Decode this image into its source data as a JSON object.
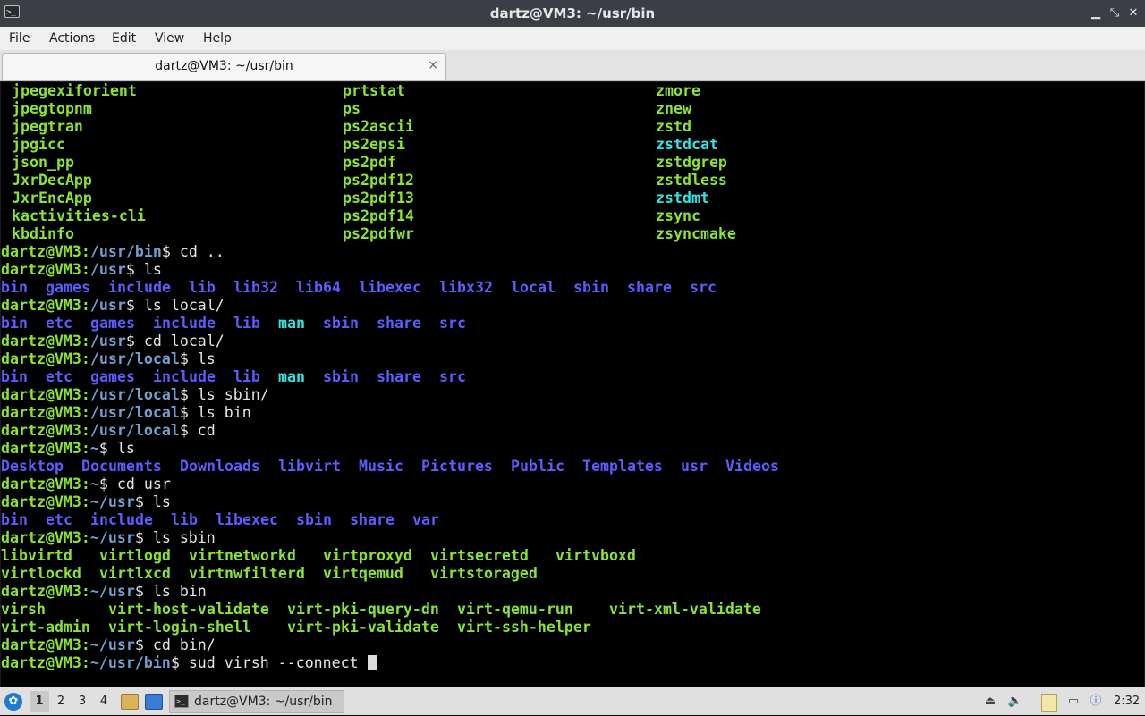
{
  "window": {
    "title": "dartz@VM3: ~/usr/bin",
    "buttons": {
      "minimize": "▁",
      "maximize": "⤡",
      "close": "✕"
    }
  },
  "menu": [
    "File",
    "Actions",
    "Edit",
    "View",
    "Help"
  ],
  "tab": {
    "label": "dartz@VM3: ~/usr/bin",
    "close": "×"
  },
  "terminal": {
    "listing_rows": [
      [
        "jpegexiforient",
        "prtstat",
        "zmore"
      ],
      [
        "jpegtopnm",
        "ps",
        "znew"
      ],
      [
        "jpegtran",
        "ps2ascii",
        "zstd"
      ],
      [
        "jpgicc",
        "ps2epsi",
        "zstdcat"
      ],
      [
        "json_pp",
        "ps2pdf",
        "zstdgrep"
      ],
      [
        "JxrDecApp",
        "ps2pdf12",
        "zstdless"
      ],
      [
        "JxrEncApp",
        "ps2pdf13",
        "zstdmt"
      ],
      [
        "kactivities-cli",
        "ps2pdf14",
        "zsync"
      ],
      [
        "kbdinfo",
        "ps2pdfwr",
        "zsyncmake"
      ]
    ],
    "prompt_user": "dartz@VM3:",
    "history": [
      {
        "path": "/usr/bin",
        "cmd": " cd .."
      },
      {
        "path": "/usr",
        "cmd": " ls"
      },
      {
        "path": "/usr",
        "cmd": " ls local/"
      },
      {
        "path": "/usr",
        "cmd": " cd local/"
      },
      {
        "path": "/usr/local",
        "cmd": " ls"
      },
      {
        "path": "/usr/local",
        "cmd": " ls sbin/"
      },
      {
        "path": "/usr/local",
        "cmd": " ls bin"
      },
      {
        "path": "/usr/local",
        "cmd": " cd"
      },
      {
        "path": "~",
        "cmd": " ls"
      },
      {
        "path": "~",
        "cmd": " cd usr"
      },
      {
        "path": "~/usr",
        "cmd": " ls"
      },
      {
        "path": "~/usr",
        "cmd": " ls sbin"
      },
      {
        "path": "~/usr",
        "cmd": " ls bin"
      },
      {
        "path": "~/usr",
        "cmd": " cd bin/"
      },
      {
        "path": "~/usr/bin",
        "cmd": " sud virsh --connect "
      }
    ],
    "outputs": {
      "usr_ls": [
        "bin",
        "games",
        "include",
        "lib",
        "lib32",
        "lib64",
        "libexec",
        "libx32",
        "local",
        "sbin",
        "share",
        "src"
      ],
      "local_ls": [
        "bin",
        "etc",
        "games",
        "include",
        "lib",
        "man",
        "sbin",
        "share",
        "src"
      ],
      "local_ls2": [
        "bin",
        "etc",
        "games",
        "include",
        "lib",
        "man",
        "sbin",
        "share",
        "src"
      ],
      "home_ls": [
        "Desktop",
        "Documents",
        "Downloads",
        "libvirt",
        "Music",
        "Pictures",
        "Public",
        "Templates",
        "usr",
        "Videos"
      ],
      "home_usr_ls": [
        "bin",
        "etc",
        "include",
        "lib",
        "libexec",
        "sbin",
        "share",
        "var"
      ],
      "sbin_row1": [
        "libvirtd",
        "virtlogd",
        "virtnetworkd",
        "virtproxyd",
        "virtsecretd",
        "virtvboxd"
      ],
      "sbin_row2": [
        "virtlockd",
        "virtlxcd",
        "virtnwfilterd",
        "virtqemud",
        "virtstoraged"
      ],
      "bin_row1": [
        "virsh",
        "virt-host-validate",
        "virt-pki-query-dn",
        "virt-qemu-run",
        "virt-xml-validate"
      ],
      "bin_row2": [
        "virt-admin",
        "virt-login-shell",
        "virt-pki-validate",
        "virt-ssh-helper"
      ]
    }
  },
  "taskbar": {
    "workspaces": [
      "1",
      "2",
      "3",
      "4"
    ],
    "task_label": "dartz@VM3: ~/usr/bin",
    "clock": "2:32",
    "icons": [
      "start-menu-icon",
      "file-manager-icon",
      "desktop-icon",
      "terminal-icon",
      "disk-icon",
      "volume-icon",
      "clipboard-icon",
      "monitor-icon",
      "update-notifier-icon"
    ]
  }
}
